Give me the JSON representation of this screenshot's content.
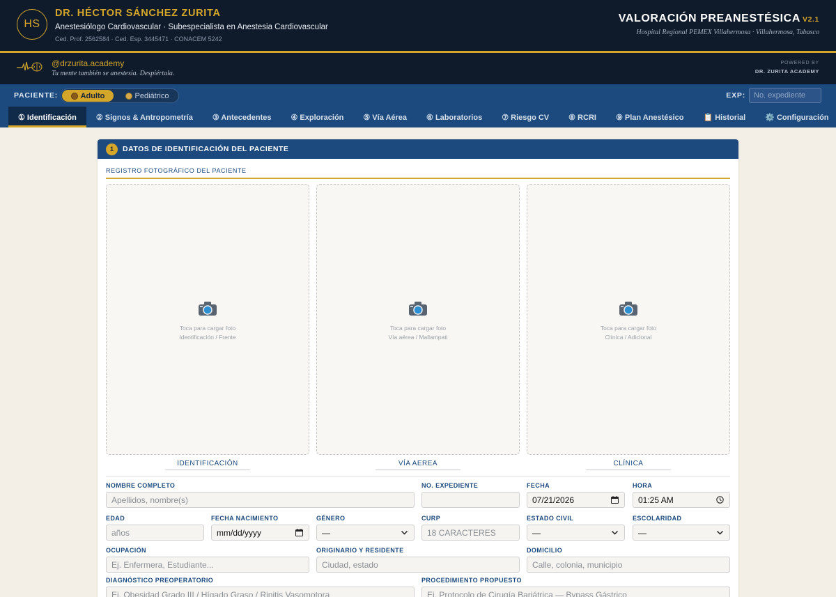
{
  "colors": {
    "navy": "#0f1b2b",
    "blue": "#1c4a7e",
    "gold": "#d4a62a",
    "page": "#f3efe6"
  },
  "header": {
    "logo_text": "HS",
    "doctor_name": "DR. HÉCTOR SÁNCHEZ ZURITA",
    "specialty": "Anestesiólogo Cardiovascular · Subespecialista en Anestesia Cardiovascular",
    "credentials": "Ced. Prof. 2562584 · Ced. Esp. 3445471 · CONACEM 5242",
    "app_title": "VALORACIÓN PREANESTÉSICA",
    "app_version": "V2.1",
    "hospital": "Hospital Regional PEMEX Villahermosa · Villahermosa, Tabasco"
  },
  "academy": {
    "icon": "ecg-brain-icon",
    "handle": "@drzurita.academy",
    "tagline": "Tu mente también se anestesia. Despiértala.",
    "powered_label": "POWERED BY",
    "powered_name": "DR. ZURITA ACADEMY"
  },
  "patient_bar": {
    "label": "PACIENTE:",
    "adult_label": "Adulto",
    "pediatric_label": "Pediátrico",
    "selected": "Adulto",
    "exp_label": "EXP:",
    "exp_placeholder": "No. expediente"
  },
  "tabs": [
    {
      "label": "① Identificación",
      "active": true
    },
    {
      "label": "② Signos & Antropometría",
      "active": false
    },
    {
      "label": "③ Antecedentes",
      "active": false
    },
    {
      "label": "④ Exploración",
      "active": false
    },
    {
      "label": "⑤ Vía Aérea",
      "active": false
    },
    {
      "label": "⑥ Laboratorios",
      "active": false
    },
    {
      "label": "⑦ Riesgo CV",
      "active": false
    },
    {
      "label": "⑧ RCRI",
      "active": false
    },
    {
      "label": "⑨ Plan Anestésico",
      "active": false
    },
    {
      "label": "📋 Historial",
      "active": false
    },
    {
      "label": "⚙️ Configuración",
      "active": false
    }
  ],
  "card": {
    "step": "1",
    "title": "DATOS DE IDENTIFICACIÓN DEL PACIENTE",
    "photo_section": "REGISTRO FOTOGRÁFICO DEL PACIENTE",
    "photos": [
      {
        "prompt": "Toca para cargar foto",
        "subtitle": "Identificación / Frente",
        "caption": "IDENTIFICACIÓN"
      },
      {
        "prompt": "Toca para cargar foto",
        "subtitle": "Vía aérea / Mallampati",
        "caption": "VÍA AEREA"
      },
      {
        "prompt": "Toca para cargar foto",
        "subtitle": "Clínica / Adicional",
        "caption": "CLÍNICA"
      }
    ]
  },
  "form": {
    "nombre": {
      "label": "NOMBRE COMPLETO",
      "placeholder": "Apellidos, nombre(s)"
    },
    "expediente": {
      "label": "NO. EXPEDIENTE",
      "value": ""
    },
    "fecha": {
      "label": "FECHA",
      "value": "07/21/2026"
    },
    "hora": {
      "label": "HORA",
      "value": "01:25 AM"
    },
    "edad": {
      "label": "EDAD",
      "placeholder": "años"
    },
    "fecha_nac": {
      "label": "FECHA NACIMIENTO",
      "placeholder": "mm/dd/yyyy"
    },
    "genero": {
      "label": "GÉNERO",
      "value": "—"
    },
    "curp": {
      "label": "CURP",
      "placeholder": "18 CARACTERES"
    },
    "estado_civil": {
      "label": "ESTADO CIVIL",
      "value": "—"
    },
    "escolaridad": {
      "label": "ESCOLARIDAD",
      "value": "—"
    },
    "ocupacion": {
      "label": "OCUPACIÓN",
      "placeholder": "Ej. Enfermera, Estudiante..."
    },
    "origen": {
      "label": "ORIGINARIO Y RESIDENTE",
      "placeholder": "Ciudad, estado"
    },
    "domicilio": {
      "label": "DOMICILIO",
      "placeholder": "Calle, colonia, municipio"
    },
    "diagnostico": {
      "label": "DIAGNÓSTICO PREOPERATORIO",
      "placeholder": "Ej. Obesidad Grado III / Hígado Graso / Rinitis Vasomotora"
    },
    "procedimiento": {
      "label": "PROCEDIMIENTO PROPUESTO",
      "placeholder": "Ej. Protocolo de Cirugía Bariátrica — Bypass Gástrico"
    }
  }
}
